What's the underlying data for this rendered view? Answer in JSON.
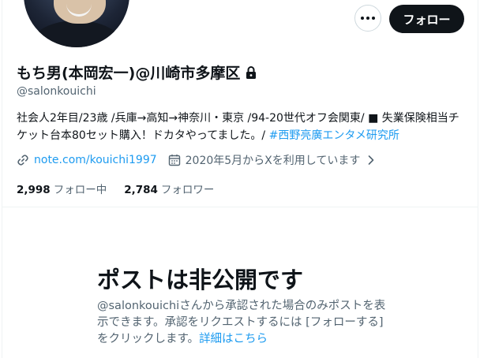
{
  "profile": {
    "display_name": "もち男(本岡宏一)@川崎市多摩区",
    "handle": "@salonkouichi",
    "bio_text": "社会人2年目/23歳 /兵庫→高知→神奈川・東京 /94-20世代オフ会関東/ ■ 失業保険相当チケット台本80セット購入！ドカタやってました。/ ",
    "bio_hashtag": "#西野亮廣エンタメ研究所",
    "website": "note.com/kouichi1997",
    "joined": "2020年5月からXを利用しています",
    "protected_icon": "lock-icon"
  },
  "actions": {
    "more_icon": "more-icon",
    "follow_label": "フォロー"
  },
  "stats": {
    "following_count": "2,998",
    "following_label": "フォロー中",
    "followers_count": "2,784",
    "followers_label": "フォロワー"
  },
  "private_notice": {
    "title": "ポストは非公開です",
    "description": "@salonkouichiさんから承認された場合のみポストを表示できます。承認をリクエストするには [フォローする] をクリックします。",
    "link": "詳細はこちら"
  },
  "colors": {
    "text": "#0f1419",
    "secondary": "#536471",
    "link": "#1d9bf0",
    "border": "#cfd9de"
  }
}
